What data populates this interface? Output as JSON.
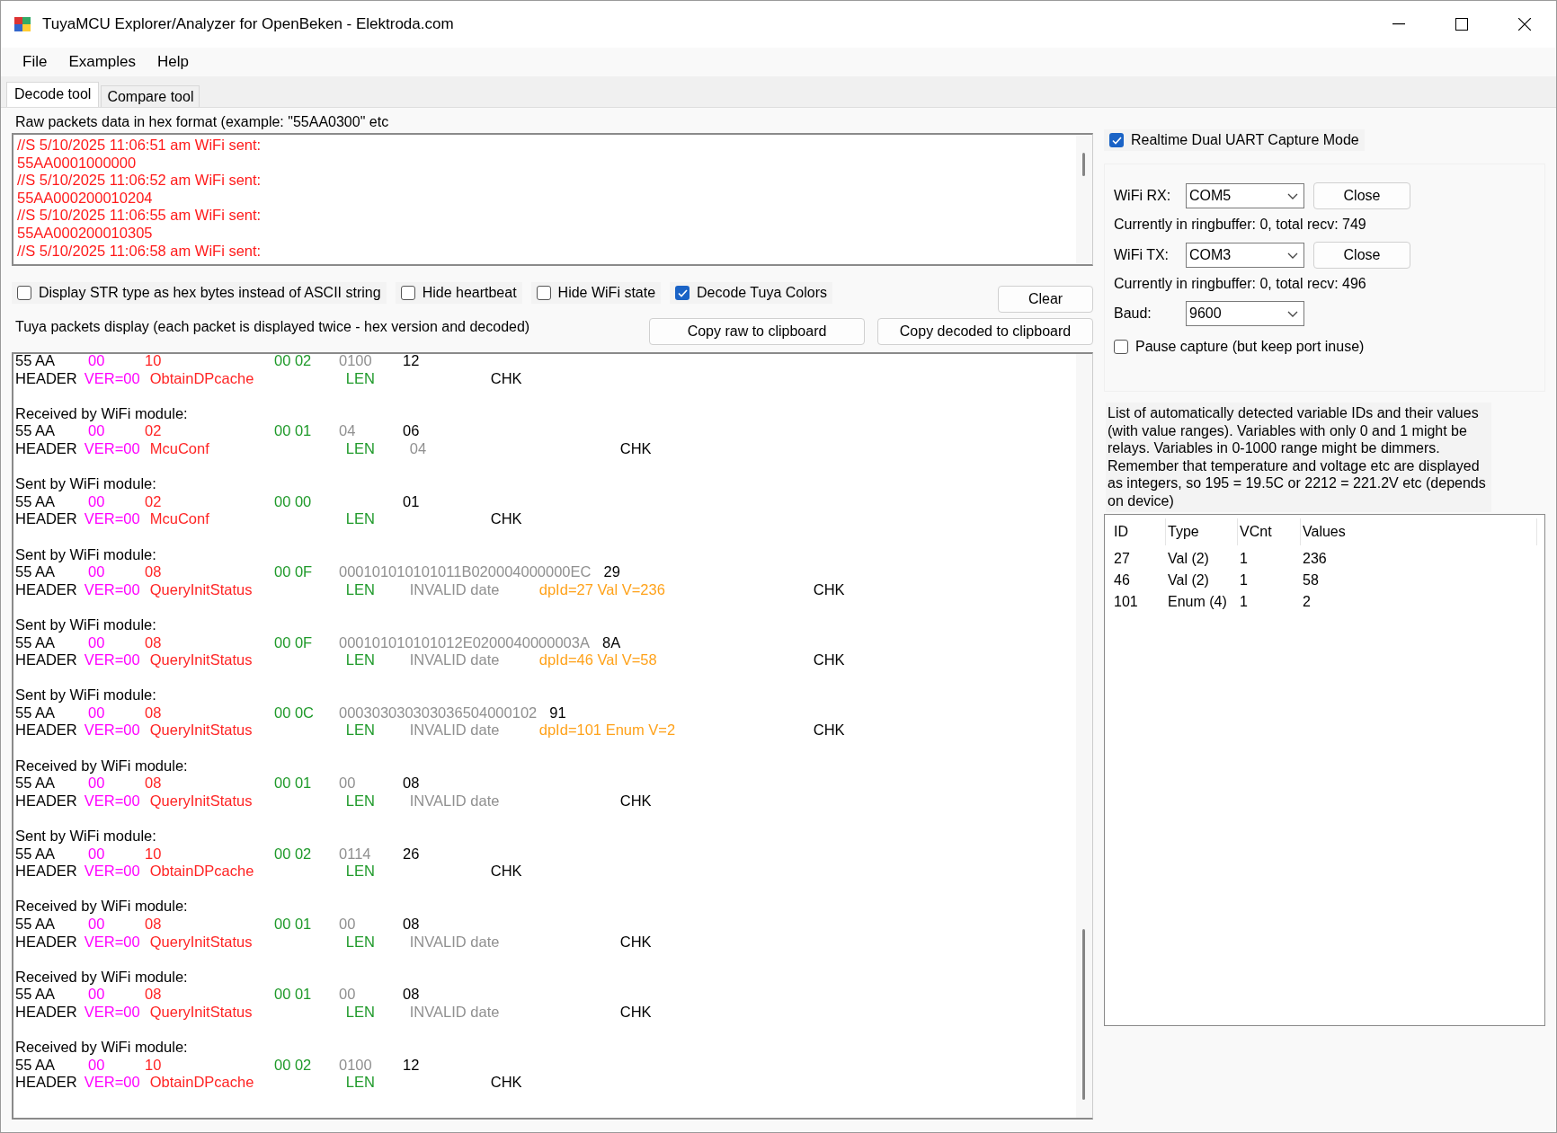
{
  "window": {
    "title": "TuyaMCU Explorer/Analyzer for OpenBeken - Elektroda.com"
  },
  "menu": [
    "File",
    "Examples",
    "Help"
  ],
  "tabs": [
    {
      "label": "Decode tool",
      "selected": true
    },
    {
      "label": "Compare tool",
      "selected": false
    }
  ],
  "raw_input": {
    "label": "Raw packets data in hex format (example: \"55AA0300\" etc",
    "lines": [
      "//S 5/10/2025 11:06:51 am WiFi sent:",
      "55AA0001000000",
      "//S 5/10/2025 11:06:52 am WiFi sent:",
      "55AA000200010204",
      "//S 5/10/2025 11:06:55 am WiFi sent:",
      "55AA000200010305",
      "//S 5/10/2025 11:06:58 am WiFi sent:"
    ]
  },
  "options": [
    {
      "label": "Display STR type as hex bytes instead of ASCII string",
      "checked": false
    },
    {
      "label": "Hide heartbeat",
      "checked": false
    },
    {
      "label": "Hide WiFi state",
      "checked": false
    },
    {
      "label": "Decode Tuya Colors",
      "checked": true
    }
  ],
  "clear_button": "Clear",
  "packets_display": {
    "label": "Tuya packets display (each packet is displayed twice - hex version and decoded)",
    "copy_raw_button": "Copy raw to clipboard",
    "copy_decoded_button": "Copy decoded to clipboard",
    "packets": [
      {
        "hex": [
          {
            "text": "55 AA",
            "kind": "sync"
          },
          {
            "text": "00",
            "kind": "ver"
          },
          {
            "text": "10",
            "kind": "cmd"
          },
          {
            "text": "00 02",
            "kind": "len"
          },
          {
            "text": "0100",
            "kind": "data"
          },
          {
            "text": "12",
            "kind": "chk"
          }
        ],
        "decoded": [
          {
            "text": "HEADER",
            "kind": "sync"
          },
          {
            "text": "VER=00",
            "kind": "ver"
          },
          {
            "text": "ObtainDPcache",
            "kind": "cmd"
          },
          {
            "text": "LEN",
            "kind": "len"
          },
          {
            "text": "CHK",
            "kind": "chk"
          }
        ]
      },
      {
        "direction": "Received by WiFi module:",
        "hex": [
          {
            "text": "55 AA",
            "kind": "sync"
          },
          {
            "text": "00",
            "kind": "ver"
          },
          {
            "text": "02",
            "kind": "cmd"
          },
          {
            "text": "00 01",
            "kind": "len"
          },
          {
            "text": "04",
            "kind": "data"
          },
          {
            "text": "06",
            "kind": "chk"
          }
        ],
        "decoded": [
          {
            "text": "HEADER",
            "kind": "sync"
          },
          {
            "text": "VER=00",
            "kind": "ver"
          },
          {
            "text": "McuConf",
            "kind": "cmd"
          },
          {
            "text": "LEN",
            "kind": "len"
          },
          {
            "text": "04",
            "kind": "data"
          },
          {
            "text": "CHK",
            "kind": "chk"
          }
        ]
      },
      {
        "direction": "Sent by WiFi module:",
        "hex": [
          {
            "text": "55 AA",
            "kind": "sync"
          },
          {
            "text": "00",
            "kind": "ver"
          },
          {
            "text": "02",
            "kind": "cmd"
          },
          {
            "text": "00 00",
            "kind": "len"
          },
          {
            "text": "01",
            "kind": "chk"
          }
        ],
        "decoded": [
          {
            "text": "HEADER",
            "kind": "sync"
          },
          {
            "text": "VER=00",
            "kind": "ver"
          },
          {
            "text": "McuConf",
            "kind": "cmd"
          },
          {
            "text": "LEN",
            "kind": "len"
          },
          {
            "text": "CHK",
            "kind": "chk"
          }
        ]
      },
      {
        "direction": "Sent by WiFi module:",
        "hex": [
          {
            "text": "55 AA",
            "kind": "sync"
          },
          {
            "text": "00",
            "kind": "ver"
          },
          {
            "text": "08",
            "kind": "cmd"
          },
          {
            "text": "00 0F",
            "kind": "len"
          },
          {
            "text": "000101010101011B020004000000EC",
            "kind": "data"
          },
          {
            "text": "29",
            "kind": "chk"
          }
        ],
        "decoded": [
          {
            "text": "HEADER",
            "kind": "sync"
          },
          {
            "text": "VER=00",
            "kind": "ver"
          },
          {
            "text": "QueryInitStatus",
            "kind": "cmd"
          },
          {
            "text": "LEN",
            "kind": "len"
          },
          {
            "text": "INVALID date",
            "kind": "data"
          },
          {
            "text": "dpId=27 Val V=236",
            "kind": "dp"
          },
          {
            "text": "CHK",
            "kind": "chk"
          }
        ]
      },
      {
        "direction": "Sent by WiFi module:",
        "hex": [
          {
            "text": "55 AA",
            "kind": "sync"
          },
          {
            "text": "00",
            "kind": "ver"
          },
          {
            "text": "08",
            "kind": "cmd"
          },
          {
            "text": "00 0F",
            "kind": "len"
          },
          {
            "text": "000101010101012E0200040000003A",
            "kind": "data"
          },
          {
            "text": "8A",
            "kind": "chk"
          }
        ],
        "decoded": [
          {
            "text": "HEADER",
            "kind": "sync"
          },
          {
            "text": "VER=00",
            "kind": "ver"
          },
          {
            "text": "QueryInitStatus",
            "kind": "cmd"
          },
          {
            "text": "LEN",
            "kind": "len"
          },
          {
            "text": "INVALID date",
            "kind": "data"
          },
          {
            "text": "dpId=46 Val V=58",
            "kind": "dp"
          },
          {
            "text": "CHK",
            "kind": "chk"
          }
        ]
      },
      {
        "direction": "Sent by WiFi module:",
        "hex": [
          {
            "text": "55 AA",
            "kind": "sync"
          },
          {
            "text": "00",
            "kind": "ver"
          },
          {
            "text": "08",
            "kind": "cmd"
          },
          {
            "text": "00 0C",
            "kind": "len"
          },
          {
            "text": "000303030303036504000102",
            "kind": "data"
          },
          {
            "text": "91",
            "kind": "chk"
          }
        ],
        "decoded": [
          {
            "text": "HEADER",
            "kind": "sync"
          },
          {
            "text": "VER=00",
            "kind": "ver"
          },
          {
            "text": "QueryInitStatus",
            "kind": "cmd"
          },
          {
            "text": "LEN",
            "kind": "len"
          },
          {
            "text": "INVALID date",
            "kind": "data"
          },
          {
            "text": "dpId=101 Enum V=2",
            "kind": "dp"
          },
          {
            "text": "CHK",
            "kind": "chk"
          }
        ]
      },
      {
        "direction": "Received by WiFi module:",
        "hex": [
          {
            "text": "55 AA",
            "kind": "sync"
          },
          {
            "text": "00",
            "kind": "ver"
          },
          {
            "text": "08",
            "kind": "cmd"
          },
          {
            "text": "00 01",
            "kind": "len"
          },
          {
            "text": "00",
            "kind": "data"
          },
          {
            "text": "08",
            "kind": "chk"
          }
        ],
        "decoded": [
          {
            "text": "HEADER",
            "kind": "sync"
          },
          {
            "text": "VER=00",
            "kind": "ver"
          },
          {
            "text": "QueryInitStatus",
            "kind": "cmd"
          },
          {
            "text": "LEN",
            "kind": "len"
          },
          {
            "text": "INVALID date",
            "kind": "data"
          },
          {
            "text": "CHK",
            "kind": "chk"
          }
        ]
      },
      {
        "direction": "Sent by WiFi module:",
        "hex": [
          {
            "text": "55 AA",
            "kind": "sync"
          },
          {
            "text": "00",
            "kind": "ver"
          },
          {
            "text": "10",
            "kind": "cmd"
          },
          {
            "text": "00 02",
            "kind": "len"
          },
          {
            "text": "0114",
            "kind": "data"
          },
          {
            "text": "26",
            "kind": "chk"
          }
        ],
        "decoded": [
          {
            "text": "HEADER",
            "kind": "sync"
          },
          {
            "text": "VER=00",
            "kind": "ver"
          },
          {
            "text": "ObtainDPcache",
            "kind": "cmd"
          },
          {
            "text": "LEN",
            "kind": "len"
          },
          {
            "text": "CHK",
            "kind": "chk"
          }
        ]
      },
      {
        "direction": "Received by WiFi module:",
        "hex": [
          {
            "text": "55 AA",
            "kind": "sync"
          },
          {
            "text": "00",
            "kind": "ver"
          },
          {
            "text": "08",
            "kind": "cmd"
          },
          {
            "text": "00 01",
            "kind": "len"
          },
          {
            "text": "00",
            "kind": "data"
          },
          {
            "text": "08",
            "kind": "chk"
          }
        ],
        "decoded": [
          {
            "text": "HEADER",
            "kind": "sync"
          },
          {
            "text": "VER=00",
            "kind": "ver"
          },
          {
            "text": "QueryInitStatus",
            "kind": "cmd"
          },
          {
            "text": "LEN",
            "kind": "len"
          },
          {
            "text": "INVALID date",
            "kind": "data"
          },
          {
            "text": "CHK",
            "kind": "chk"
          }
        ]
      },
      {
        "direction": "Received by WiFi module:",
        "hex": [
          {
            "text": "55 AA",
            "kind": "sync"
          },
          {
            "text": "00",
            "kind": "ver"
          },
          {
            "text": "08",
            "kind": "cmd"
          },
          {
            "text": "00 01",
            "kind": "len"
          },
          {
            "text": "00",
            "kind": "data"
          },
          {
            "text": "08",
            "kind": "chk"
          }
        ],
        "decoded": [
          {
            "text": "HEADER",
            "kind": "sync"
          },
          {
            "text": "VER=00",
            "kind": "ver"
          },
          {
            "text": "QueryInitStatus",
            "kind": "cmd"
          },
          {
            "text": "LEN",
            "kind": "len"
          },
          {
            "text": "INVALID date",
            "kind": "data"
          },
          {
            "text": "CHK",
            "kind": "chk"
          }
        ]
      },
      {
        "direction": "Received by WiFi module:",
        "hex": [
          {
            "text": "55 AA",
            "kind": "sync"
          },
          {
            "text": "00",
            "kind": "ver"
          },
          {
            "text": "10",
            "kind": "cmd"
          },
          {
            "text": "00 02",
            "kind": "len"
          },
          {
            "text": "0100",
            "kind": "data"
          },
          {
            "text": "12",
            "kind": "chk"
          }
        ],
        "decoded": [
          {
            "text": "HEADER",
            "kind": "sync"
          },
          {
            "text": "VER=00",
            "kind": "ver"
          },
          {
            "text": "ObtainDPcache",
            "kind": "cmd"
          },
          {
            "text": "LEN",
            "kind": "len"
          },
          {
            "text": "CHK",
            "kind": "chk"
          }
        ]
      }
    ]
  },
  "capture": {
    "realtime": {
      "label": "Realtime Dual UART Capture Mode",
      "checked": true
    },
    "ports": [
      {
        "label": "WiFi RX:",
        "value": "COM5",
        "button": "Close",
        "status": "Currently in ringbuffer: 0, total recv: 749"
      },
      {
        "label": "WiFi TX:",
        "value": "COM3",
        "button": "Close",
        "status": "Currently in ringbuffer: 0, total recv: 496"
      }
    ],
    "baud": {
      "label": "Baud:",
      "value": "9600"
    },
    "pause": {
      "label": "Pause capture (but keep port inuse)",
      "checked": false
    }
  },
  "variables": {
    "description": "List of automatically detected variable IDs  and their values (with value ranges). Variables with only 0 and 1 might be relays. Variables in 0-1000 range might be dimmers. Remember that temperature and voltage etc are displayed as integers, so 195 = 19.5C or 2212 = 221.2V etc (depends on device)",
    "columns": [
      "ID",
      "Type",
      "VCnt",
      "Values"
    ],
    "rows": [
      [
        "27",
        "Val (2)",
        "1",
        "236"
      ],
      [
        "46",
        "Val (2)",
        "1",
        "58"
      ],
      [
        "101",
        "Enum (4)",
        "1",
        "2"
      ]
    ]
  }
}
